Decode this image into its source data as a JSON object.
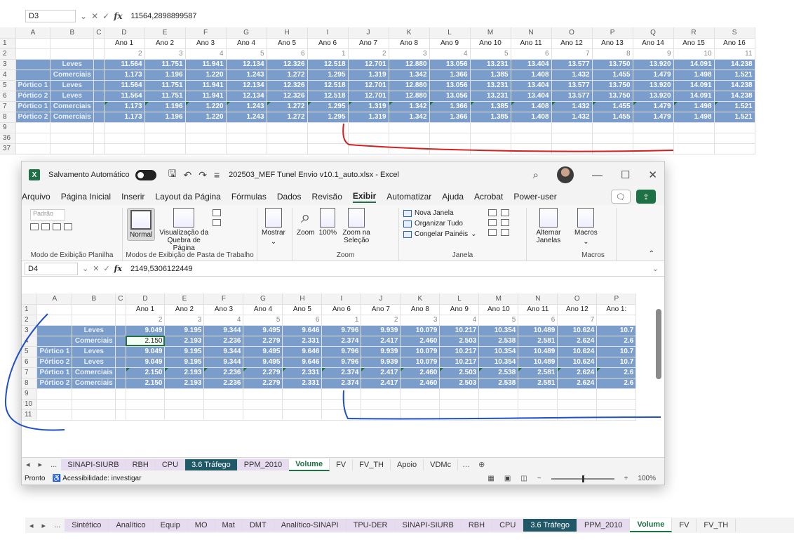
{
  "bg": {
    "name_box": "D3",
    "formula": "11564,2898899587",
    "col_headers": [
      "A",
      "B",
      "C",
      "D",
      "E",
      "F",
      "G",
      "H",
      "I",
      "J",
      "K",
      "L",
      "M",
      "N",
      "O",
      "P",
      "Q",
      "R",
      "S"
    ],
    "year_labels": [
      "Ano 1",
      "Ano 2",
      "Ano 3",
      "Ano 4",
      "Ano 5",
      "Ano 6",
      "Ano 7",
      "Ano 8",
      "Ano 9",
      "Ano 10",
      "Ano 11",
      "Ano 12",
      "Ano 13",
      "Ano 14",
      "Ano 15",
      "Ano 16"
    ],
    "index_row": [
      "2",
      "3",
      "4",
      "5",
      "6",
      "1",
      "2",
      "3",
      "4",
      "5",
      "6",
      "7",
      "8",
      "9",
      "10",
      "11"
    ],
    "rows": [
      {
        "r": "3",
        "a": "",
        "b": "Leves",
        "v": [
          "11.564",
          "11.751",
          "11.941",
          "12.134",
          "12.326",
          "12.518",
          "12.701",
          "12.880",
          "13.056",
          "13.231",
          "13.404",
          "13.577",
          "13.750",
          "13.920",
          "14.091",
          "14.238"
        ]
      },
      {
        "r": "4",
        "a": "",
        "b": "Comerciais",
        "v": [
          "1.173",
          "1.196",
          "1.220",
          "1.243",
          "1.272",
          "1.295",
          "1.319",
          "1.342",
          "1.366",
          "1.385",
          "1.408",
          "1.432",
          "1.455",
          "1.479",
          "1.498",
          "1.521"
        ]
      },
      {
        "r": "5",
        "a": "Pórtico 1",
        "b": "Leves",
        "v": [
          "11.564",
          "11.751",
          "11.941",
          "12.134",
          "12.326",
          "12.518",
          "12.701",
          "12.880",
          "13.056",
          "13.231",
          "13.404",
          "13.577",
          "13.750",
          "13.920",
          "14.091",
          "14.238"
        ]
      },
      {
        "r": "6",
        "a": "Pórtico 2",
        "b": "Leves",
        "v": [
          "11.564",
          "11.751",
          "11.941",
          "12.134",
          "12.326",
          "12.518",
          "12.701",
          "12.880",
          "13.056",
          "13.231",
          "13.404",
          "13.577",
          "13.750",
          "13.920",
          "14.091",
          "14.238"
        ]
      },
      {
        "r": "7",
        "a": "Pórtico 1",
        "b": "Comerciais",
        "v": [
          "1.173",
          "1.196",
          "1.220",
          "1.243",
          "1.272",
          "1.295",
          "1.319",
          "1.342",
          "1.366",
          "1.385",
          "1.408",
          "1.432",
          "1.455",
          "1.479",
          "1.498",
          "1.521"
        ]
      },
      {
        "r": "8",
        "a": "Pórtico 2",
        "b": "Comerciais",
        "v": [
          "1.173",
          "1.196",
          "1.220",
          "1.243",
          "1.272",
          "1.295",
          "1.319",
          "1.342",
          "1.366",
          "1.385",
          "1.408",
          "1.432",
          "1.455",
          "1.479",
          "1.498",
          "1.521"
        ]
      }
    ],
    "extra_rows": [
      "9",
      "36",
      "37"
    ],
    "tabs": [
      "Sintético",
      "Analítico",
      "Equip",
      "MO",
      "Mat",
      "DMT",
      "Analítico-SINAPI",
      "TPU-DER",
      "SINAPI-SIURB",
      "RBH",
      "CPU",
      "3.6 Tráfego",
      "PPM_2010",
      "Volume",
      "FV",
      "FV_TH"
    ],
    "tab_nav": [
      "◂",
      "▸",
      "..."
    ]
  },
  "win": {
    "autosave": "Salvamento Automático",
    "doc_title": "202503_MEF Tunel Envio v10.1_auto.xlsx - Excel",
    "window_controls": [
      "—",
      "☐",
      "✕"
    ],
    "menu": [
      "Arquivo",
      "Página Inicial",
      "Inserir",
      "Layout da Página",
      "Fórmulas",
      "Dados",
      "Revisão",
      "Exibir",
      "Automatizar",
      "Ajuda",
      "Acrobat",
      "Power-user"
    ],
    "ribbon": {
      "padrao": "Padrão",
      "g1": "Modo de Exibição Planilha",
      "normal": "Normal",
      "quebra": "Visualização da Quebra de Página",
      "g2": "Modos de Exibição de Pasta de Trabalho",
      "mostrar": "Mostrar",
      "zoom": "Zoom",
      "zoom100": "100%",
      "zoomsel": "Zoom na Seleção",
      "g3": "Zoom",
      "nova": "Nova Janela",
      "organizar": "Organizar Tudo",
      "congelar": "Congelar Painéis",
      "alternar": "Alternar Janelas",
      "g4": "Janela",
      "macros": "Macros",
      "g5": "Macros"
    },
    "name_box": "D4",
    "formula": "2149,5306122449",
    "col_headers": [
      "A",
      "B",
      "C",
      "D",
      "E",
      "F",
      "G",
      "H",
      "I",
      "J",
      "K",
      "L",
      "M",
      "N",
      "O",
      "P"
    ],
    "year_labels": [
      "Ano 1",
      "Ano 2",
      "Ano 3",
      "Ano 4",
      "Ano 5",
      "Ano 6",
      "Ano 7",
      "Ano 8",
      "Ano 9",
      "Ano 10",
      "Ano 11",
      "Ano 12",
      "Ano 1:"
    ],
    "index_row": [
      "2",
      "3",
      "4",
      "5",
      "6",
      "1",
      "2",
      "3",
      "4",
      "5",
      "6",
      "7",
      ""
    ],
    "rows": [
      {
        "r": "3",
        "a": "",
        "b": "Leves",
        "v": [
          "9.049",
          "9.195",
          "9.344",
          "9.495",
          "9.646",
          "9.796",
          "9.939",
          "10.079",
          "10.217",
          "10.354",
          "10.489",
          "10.624",
          "10.7"
        ]
      },
      {
        "r": "4",
        "a": "",
        "b": "Comerciais",
        "v": [
          "2.150",
          "2.193",
          "2.236",
          "2.279",
          "2.331",
          "2.374",
          "2.417",
          "2.460",
          "2.503",
          "2.538",
          "2.581",
          "2.624",
          "2.6"
        ]
      },
      {
        "r": "5",
        "a": "Pórtico 1",
        "b": "Leves",
        "v": [
          "9.049",
          "9.195",
          "9.344",
          "9.495",
          "9.646",
          "9.796",
          "9.939",
          "10.079",
          "10.217",
          "10.354",
          "10.489",
          "10.624",
          "10.7"
        ]
      },
      {
        "r": "6",
        "a": "Pórtico 2",
        "b": "Leves",
        "v": [
          "9.049",
          "9.195",
          "9.344",
          "9.495",
          "9.646",
          "9.796",
          "9.939",
          "10.079",
          "10.217",
          "10.354",
          "10.489",
          "10.624",
          "10.7"
        ]
      },
      {
        "r": "7",
        "a": "Pórtico 1",
        "b": "Comerciais",
        "v": [
          "2.150",
          "2.193",
          "2.236",
          "2.279",
          "2.331",
          "2.374",
          "2.417",
          "2.460",
          "2.503",
          "2.538",
          "2.581",
          "2.624",
          "2.6"
        ]
      },
      {
        "r": "8",
        "a": "Pórtico 2",
        "b": "Comerciais",
        "v": [
          "2.150",
          "2.193",
          "2.236",
          "2.279",
          "2.331",
          "2.374",
          "2.417",
          "2.460",
          "2.503",
          "2.538",
          "2.581",
          "2.624",
          "2.6"
        ]
      }
    ],
    "extra_rows": [
      "9",
      "10",
      "11"
    ],
    "tabs": [
      "SINAPI-SIURB",
      "RBH",
      "CPU",
      "3.6 Tráfego",
      "PPM_2010",
      "Volume",
      "FV",
      "FV_TH",
      "Apoio",
      "VDMc"
    ],
    "tab_nav": [
      "◂",
      "▸",
      "..."
    ],
    "status": "Pronto",
    "accessibility": "Acessibilidade: investigar",
    "zoom_level": "100%"
  },
  "colors": {
    "highlight": "#7b9dcc",
    "excel_green": "#1e7145",
    "red_annot": "#d42020",
    "blue_annot": "#1f4fc9"
  }
}
